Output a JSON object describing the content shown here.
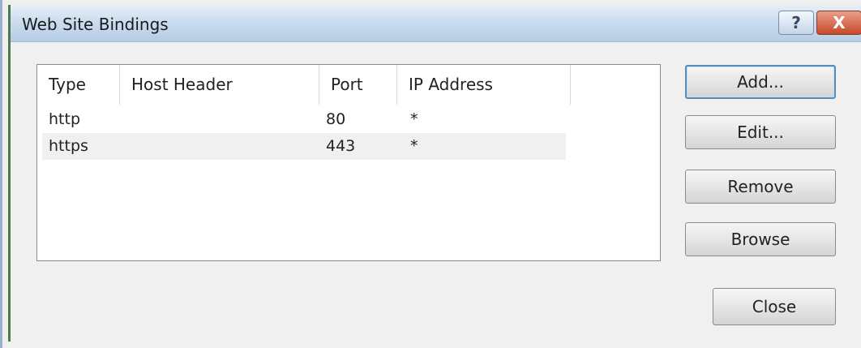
{
  "window": {
    "title": "Web Site Bindings",
    "help_glyph": "?",
    "close_glyph": "X"
  },
  "bindings": {
    "columns": [
      "Type",
      "Host Header",
      "Port",
      "IP Address"
    ],
    "rows": [
      {
        "type": "http",
        "host_header": "",
        "port": "80",
        "ip_address": "*"
      },
      {
        "type": "https",
        "host_header": "",
        "port": "443",
        "ip_address": "*"
      }
    ]
  },
  "buttons": {
    "add": "Add...",
    "edit": "Edit...",
    "remove": "Remove",
    "browse": "Browse",
    "close": "Close"
  }
}
